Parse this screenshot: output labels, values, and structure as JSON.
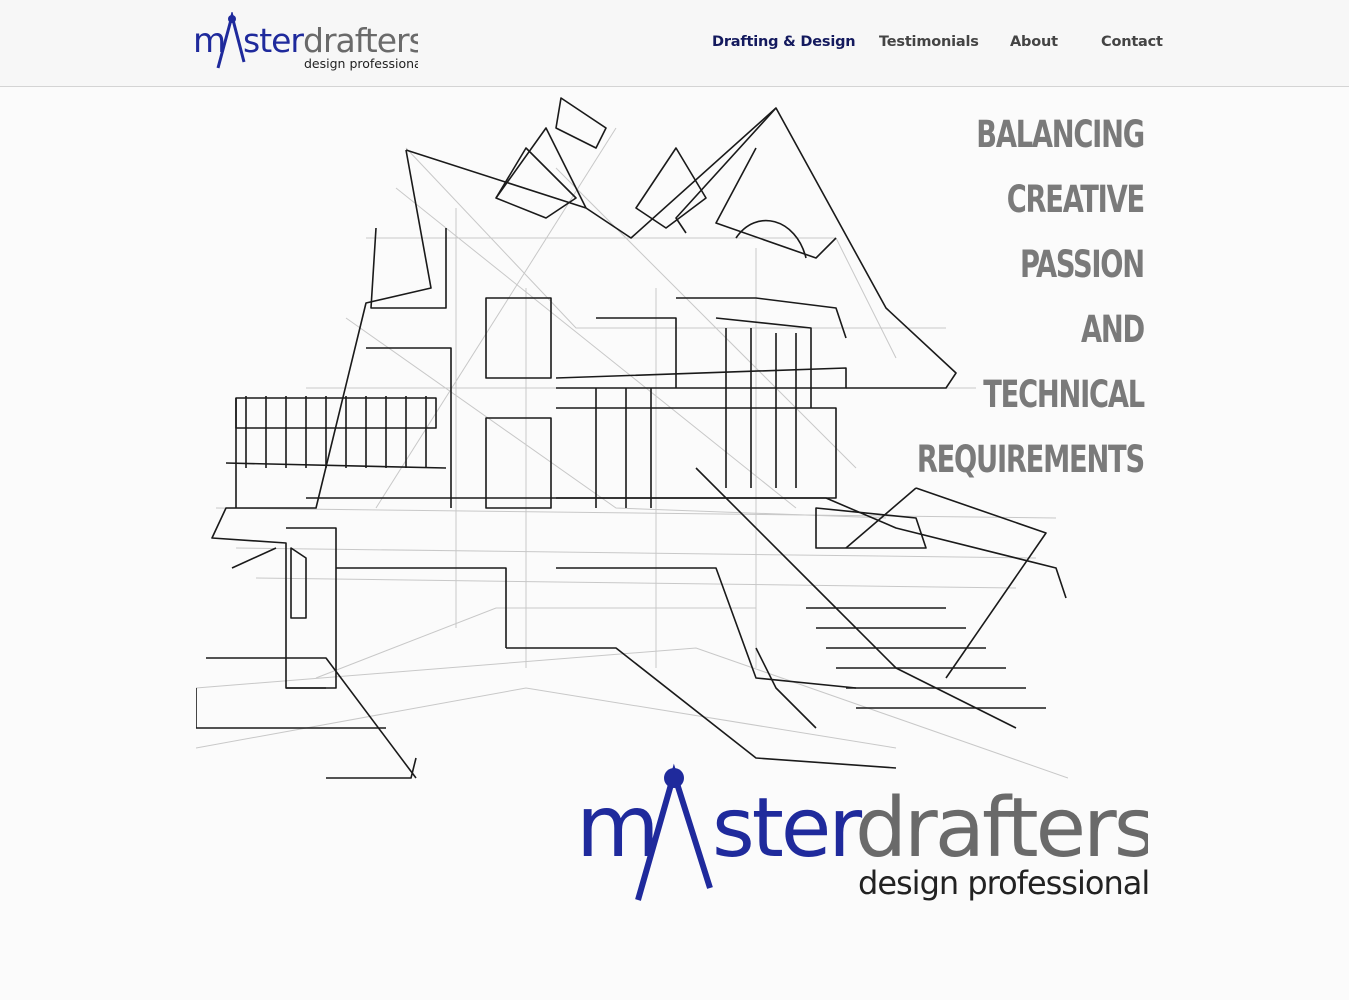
{
  "brand": {
    "name_part1": "m",
    "name_part2": "ster",
    "name_part3": "drafters",
    "tagline": "design professionals",
    "colors": {
      "blue": "#1f2a9c",
      "gray": "#6a6a6a",
      "dark": "#222222"
    }
  },
  "nav": {
    "items": [
      {
        "label": "Drafting & Design",
        "active": true
      },
      {
        "label": "Testimonials",
        "active": false
      },
      {
        "label": "About",
        "active": false
      },
      {
        "label": "Contact",
        "active": false
      }
    ],
    "colors": {
      "active": "#141a5e",
      "default": "#444444"
    }
  },
  "hero": {
    "illustration": "house-wireframe-sketch",
    "headline_lines": [
      "BALANCING",
      "CREATIVE",
      "PASSION",
      "AND",
      "TECHNICAL",
      "REQUIREMENTS"
    ],
    "headline_color": "#7a7a7a"
  }
}
